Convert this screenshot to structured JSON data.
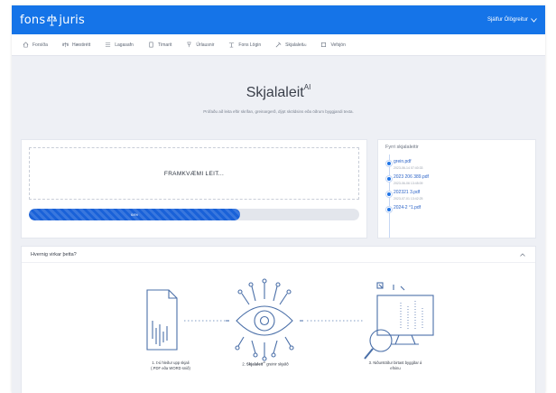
{
  "header": {
    "logo_left": "fons",
    "logo_right": "juris",
    "user_name": "Sjálfur Ólögreitur",
    "colors": {
      "brand": "#1574e8",
      "accent": "#1961d8"
    }
  },
  "nav": {
    "items": [
      {
        "icon": "home-icon",
        "label": "Forsíða"
      },
      {
        "icon": "scale-icon",
        "label": "Hæstirétt"
      },
      {
        "icon": "list-icon",
        "label": "Lagasafn"
      },
      {
        "icon": "book-icon",
        "label": "Tímarit"
      },
      {
        "icon": "gavel-icon",
        "label": "Úrlausnir"
      },
      {
        "icon": "document-icon",
        "label": "Fons Lögin"
      },
      {
        "icon": "hammer-icon",
        "label": "Skjalaleit",
        "sup": "AI"
      },
      {
        "icon": "bookmark-icon",
        "label": "Vefsjón"
      }
    ]
  },
  "hero": {
    "title": "Skjalaleit",
    "title_sup": "AI",
    "subtitle": "Prófaðu að leita eftir skrifan, greinargerð, dýpt sköldsins eða öðrum byggjandi texta."
  },
  "upload": {
    "status_text": "FRAMKVÆMI LEIT...",
    "progress_label": "64%",
    "progress": 0.64
  },
  "recent": {
    "title": "Fyrri skjalaleitir",
    "items": [
      {
        "name": "grein.pdf",
        "date": "2023-06-14 07:40:33"
      },
      {
        "name": "2023 206 389.pdf",
        "date": "2023-06-06 13:45:09"
      },
      {
        "name": "202321 3.pdf",
        "date": "2023-07-01 13:42:25"
      },
      {
        "name": "2024-2 °1.pdf",
        "date": ""
      }
    ]
  },
  "how": {
    "title": "Hvernig virkar þetta?",
    "steps": [
      {
        "line1": "1. Þú hleður upp skjali",
        "line2": "(.PDF eða WORD snið)"
      },
      {
        "bold": "Skjalaleit",
        "sup": "AI",
        "prefix": "2. ",
        "rest": " greinir skjalið"
      },
      {
        "line1": "3. Niðurstöður birtast byggðar á",
        "line2": "efninu"
      }
    ]
  }
}
